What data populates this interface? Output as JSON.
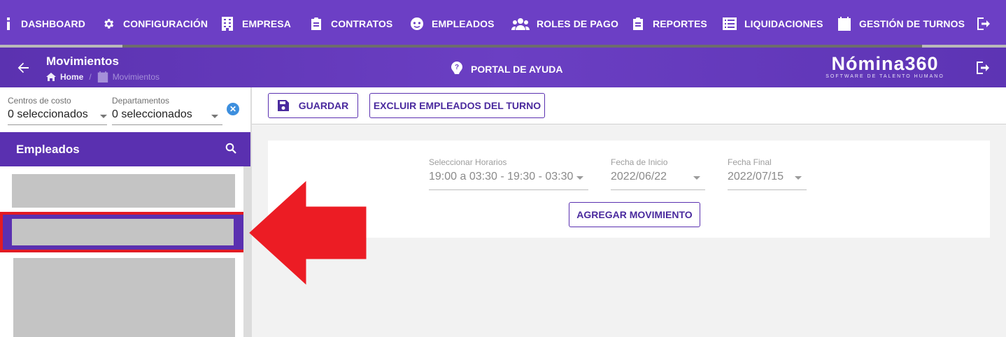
{
  "nav": {
    "items": [
      {
        "label": "DASHBOARD",
        "icon": "info-icon"
      },
      {
        "label": "CONFIGURACIÓN",
        "icon": "gear-icon"
      },
      {
        "label": "EMPRESA",
        "icon": "building-icon"
      },
      {
        "label": "CONTRATOS",
        "icon": "clipboard-icon"
      },
      {
        "label": "EMPLEADOS",
        "icon": "face-icon"
      },
      {
        "label": "ROLES DE PAGO",
        "icon": "group-icon"
      },
      {
        "label": "REPORTES",
        "icon": "clipboard-icon"
      },
      {
        "label": "LIQUIDACIONES",
        "icon": "list-icon"
      },
      {
        "label": "GESTIÓN DE TURNOS",
        "icon": "calendar-icon"
      }
    ]
  },
  "header": {
    "title": "Movimientos",
    "breadcrumb_home": "Home",
    "breadcrumb_current": "Movimientos",
    "help_label": "PORTAL DE AYUDA",
    "logo_name": "Nómina360",
    "logo_tagline": "SOFTWARE DE TALENTO HUMANO"
  },
  "filters": {
    "cost_centers_label": "Centros de costo",
    "cost_centers_value": "0 seleccionados",
    "departments_label": "Departamentos",
    "departments_value": "0 seleccionados"
  },
  "employees": {
    "title": "Empleados"
  },
  "toolbar": {
    "save_label": "GUARDAR",
    "exclude_label": "EXCLUIR EMPLEADOS DEL TURNO"
  },
  "form": {
    "schedule_label": "Seleccionar Horarios",
    "schedule_value": "19:00 a 03:30 - 19:30 - 03:30",
    "start_label": "Fecha de Inicio",
    "start_value": "2022/06/22",
    "end_label": "Fecha Final",
    "end_value": "2022/07/15",
    "add_label": "AGREGAR MOVIMIENTO"
  },
  "colors": {
    "brand": "#6c3fc5",
    "accent_dark": "#5a30b0",
    "highlight": "#e21b23"
  }
}
